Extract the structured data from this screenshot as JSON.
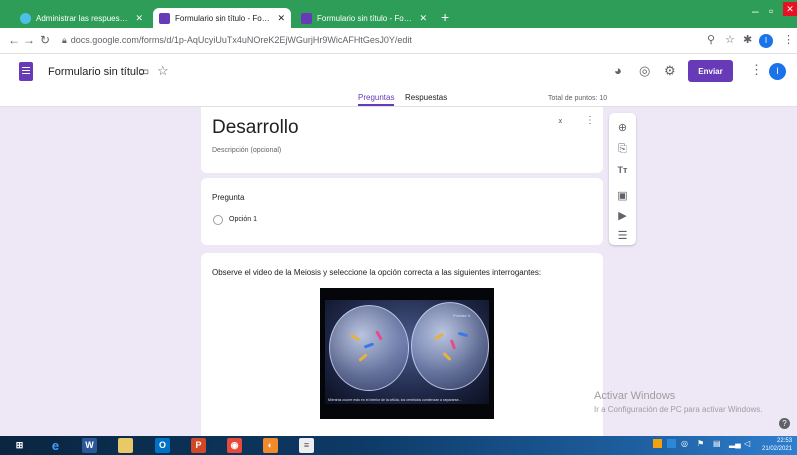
{
  "browser": {
    "tabs": [
      {
        "title": "Administrar las respuestas. - Tu..."
      },
      {
        "title": "Formulario sin título - Formulario"
      },
      {
        "title": "Formulario sin título - Formulario"
      }
    ],
    "url": "docs.google.com/forms/d/1p-AqUcyiUuTx4uNOreK2EjWGurjHr9WicAFHtGesJ0Y/edit",
    "profile_initial": "I"
  },
  "forms_header": {
    "title": "Formulario sin título",
    "send_label": "Enviar",
    "avatar_initial": "I"
  },
  "form_tabs": {
    "questions": "Preguntas",
    "responses": "Respuestas",
    "total_points": "Total de puntos: 10"
  },
  "section": {
    "title": "Desarrollo",
    "description_placeholder": "Descripción (opcional)"
  },
  "question": {
    "title": "Pregunta",
    "option1": "Opción 1"
  },
  "video_item": {
    "title": "Observe el video de la Meiosis y seleccione la opción correcta a las siguientes interrogantes:",
    "watermark": "Profase II",
    "caption": "Mientras ocurre esto en el interior de la célula, los centriolos comienzan a separarse..."
  },
  "toolbar_icons": [
    "add-question-icon",
    "import-questions-icon",
    "add-title-icon",
    "add-image-icon",
    "add-video-icon",
    "add-section-icon"
  ],
  "windows": {
    "activate_title": "Activar Windows",
    "activate_sub": "Ir a Configuración de PC para activar Windows.",
    "time": "22:53",
    "date": "21/02/2021"
  },
  "colors": {
    "accent": "#673ab7",
    "background": "#ede7f6",
    "tab_strip": "#2e9d57"
  }
}
